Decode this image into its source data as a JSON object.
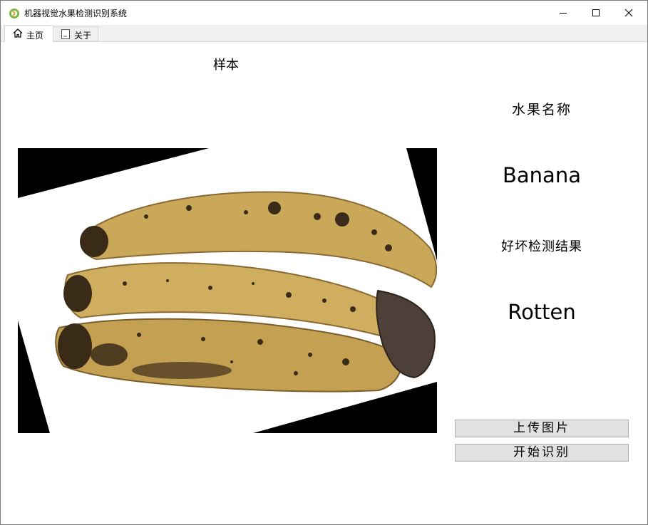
{
  "window": {
    "title": "机器视觉水果检测识别系统",
    "controls": {
      "minimize": "minimize-icon",
      "maximize": "maximize-icon",
      "close": "close-icon"
    }
  },
  "tabs": [
    {
      "label": "主页",
      "icon": "home-icon",
      "selected": true
    },
    {
      "label": "关于",
      "icon": "document-icon",
      "selected": false
    }
  ],
  "main": {
    "sample_label": "样本",
    "fruit_name_label": "水果名称",
    "fruit_name_value": "Banana",
    "quality_label": "好坏检测结果",
    "quality_value": "Rotten",
    "upload_button": "上传图片",
    "detect_button": "开始识别"
  },
  "colors": {
    "banana_peel": "#c9a85a",
    "banana_shadow": "#3a2a18",
    "button_face": "#e1e1e1"
  }
}
